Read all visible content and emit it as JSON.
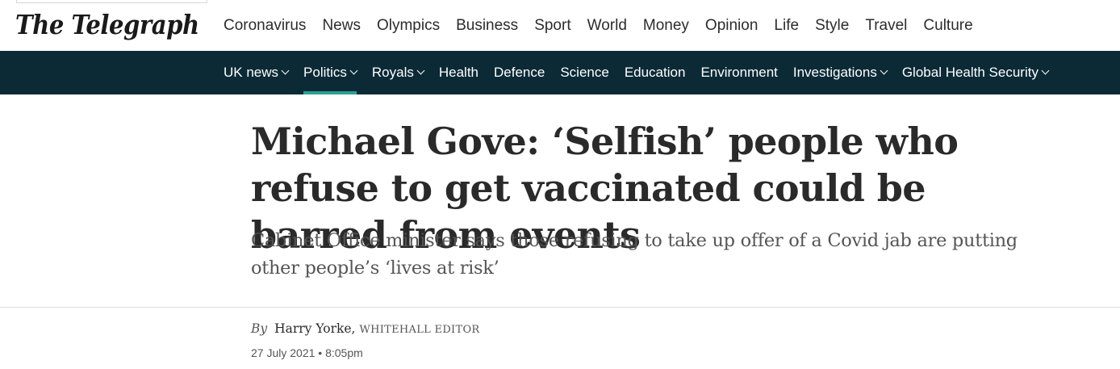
{
  "header": {
    "logo_text": "The Telegraph",
    "main_nav": [
      "Coronavirus",
      "News",
      "Olympics",
      "Business",
      "Sport",
      "World",
      "Money",
      "Opinion",
      "Life",
      "Style",
      "Travel",
      "Culture"
    ]
  },
  "subnav": {
    "items": [
      {
        "label": "UK news",
        "dropdown": true,
        "active": false
      },
      {
        "label": "Politics",
        "dropdown": true,
        "active": true
      },
      {
        "label": "Royals",
        "dropdown": true,
        "active": false
      },
      {
        "label": "Health",
        "dropdown": false,
        "active": false
      },
      {
        "label": "Defence",
        "dropdown": false,
        "active": false
      },
      {
        "label": "Science",
        "dropdown": false,
        "active": false
      },
      {
        "label": "Education",
        "dropdown": false,
        "active": false
      },
      {
        "label": "Environment",
        "dropdown": false,
        "active": false
      },
      {
        "label": "Investigations",
        "dropdown": true,
        "active": false
      },
      {
        "label": "Global Health Security",
        "dropdown": true,
        "active": false
      }
    ],
    "accent_color": "#2aa198",
    "background_color": "#0b2a36"
  },
  "article": {
    "headline": "Michael Gove: ‘Selfish’ people who refuse to get vaccinated could be barred from events",
    "standfirst": "Cabinet Office minister says those refusing to take up offer of a Covid jab are putting other people’s ‘lives at risk’",
    "byline_prefix": "By",
    "author": "Harry Yorke,",
    "author_role": "Whitehall Editor",
    "date": "27 July 2021 • 8:05pm"
  }
}
